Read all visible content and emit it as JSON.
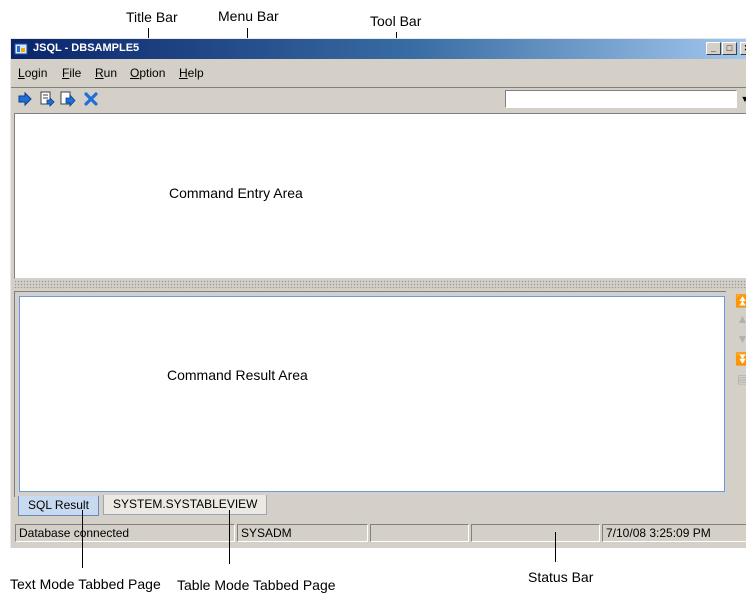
{
  "callouts": {
    "title_bar": "Title Bar",
    "menu_bar": "Menu  Bar",
    "tool_bar": "Tool Bar",
    "text_mode_tab": "Text Mode Tabbed Page",
    "table_mode_tab": "Table Mode Tabbed Page",
    "status_bar": "Status Bar"
  },
  "window": {
    "title": "JSQL - DBSAMPLE5",
    "minimize_glyph": "_",
    "maximize_glyph": "□",
    "close_glyph": "✕"
  },
  "menu": [
    {
      "mnemonic": "L",
      "rest": "ogin"
    },
    {
      "mnemonic": "F",
      "rest": "ile"
    },
    {
      "mnemonic": "R",
      "rest": "un"
    },
    {
      "mnemonic": "O",
      "rest": "ption"
    },
    {
      "mnemonic": "H",
      "rest": "elp"
    }
  ],
  "toolbar": {
    "buttons": [
      "execute-icon",
      "execute-script-icon",
      "execute-step-icon",
      "cancel-icon"
    ],
    "query_combo_value": "",
    "combo_arrow": "▼"
  },
  "areas": {
    "command_entry": "Command Entry Area",
    "command_result": "Command Result Area"
  },
  "result_nav": {
    "buttons": [
      "first-icon",
      "previous-icon",
      "next-icon",
      "last-icon",
      "export-icon"
    ],
    "glyphs": [
      "⏫",
      "▲",
      "▼",
      "⏬",
      "▤"
    ]
  },
  "tabs": {
    "sql_result": "SQL Result",
    "system_table": "SYSTEM.SYSTABLEVIEW"
  },
  "status": {
    "connection": "Database connected",
    "user": "SYSADM",
    "cell3": "",
    "cell4": "",
    "timestamp": "7/10/08 3:25:09 PM"
  },
  "colors": {
    "title_gradient_start": "#0a246a",
    "window_face": "#d4d0c8",
    "active_tab": "#c8daf0",
    "toolbar_icon_blue": "#1e6fd9"
  }
}
